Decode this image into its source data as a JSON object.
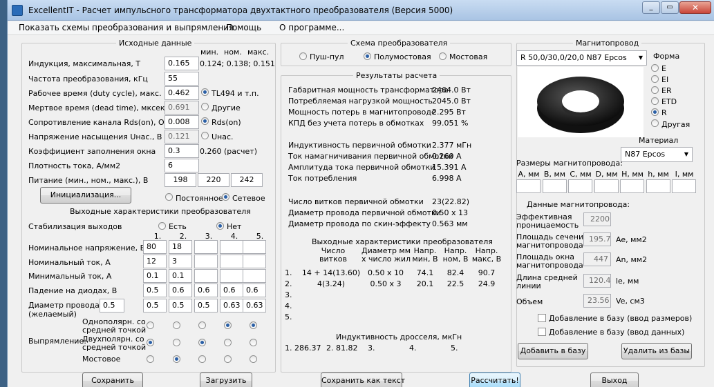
{
  "title": "ExcellentIT - Расчет импульсного трансформатора двухтактного преобразователя (Версия 5000)",
  "menu": [
    "Показать схемы преобразования и выпрямления",
    "Помощь",
    "О программе..."
  ],
  "input": {
    "header": "Исходные данные",
    "col_min": "мин.",
    "col_nom": "ном.",
    "col_max": "макс.",
    "induction_label": "Индукция, максимальная, Т",
    "induction": "0.165",
    "induction_range": "0.124; 0.138; 0.151",
    "freq_label": "Частота преобразования, кГц",
    "freq": "55",
    "duty_label": "Рабочее время (duty cycle), макс.",
    "duty": "0.462",
    "dead_label": "Мертвое время (dead time), мксек",
    "dead": "0.691",
    "rds_label": "Сопротивление канала Rds(on), Ом",
    "rds": "0.008",
    "usat_label": "Напряжение насыщения Uнас., В",
    "usat": "0.121",
    "fill_label": "Коэффициент заполнения окна",
    "fill": "0.3",
    "fill_calc": "0.260 (расчет)",
    "density_label": "Плотность тока, А/мм2",
    "density": "6",
    "supply_label": "Питание (мин., ном., макс.), В",
    "supply": [
      "198",
      "220",
      "242"
    ],
    "radio_tl494": "TL494 и т.п.",
    "radio_other": "Другие",
    "radio_rds": "Rds(on)",
    "radio_usat": "Uнас.",
    "init_btn": "Инициализация...",
    "radio_const": "Постоянное",
    "radio_mains": "Сетевое"
  },
  "outputs": {
    "header": "Выходные характеристики преобразователя",
    "stab_label": "Стабилизация выходов",
    "stab_yes": "Есть",
    "stab_no": "Нет",
    "cols": [
      "1.",
      "2.",
      "3.",
      "4.",
      "5."
    ],
    "vnom_label": "Номинальное напряжение, В",
    "vnom": [
      "80",
      "18",
      "",
      "",
      ""
    ],
    "inom_label": "Номинальный ток, А",
    "inom": [
      "12",
      "3",
      "",
      "",
      ""
    ],
    "imin_label": "Минимальный ток, А",
    "imin": [
      "0.1",
      "0.1",
      "",
      "",
      ""
    ],
    "vd_label": "Падение на диодах, В",
    "vd": [
      "0.5",
      "0.6",
      "0.6",
      "0.6",
      "0.6"
    ],
    "wire_label1": "Диаметр провода",
    "wire_label2": "(желаемый)",
    "wire_default": "0.5",
    "wire": [
      "0.5",
      "0.5",
      "0.5",
      "0.63",
      "0.63"
    ],
    "rect_label": "Выпрямление:",
    "rect_opt1a": "Однополярн. со",
    "rect_opt1b": "средней точкой",
    "rect_opt2a": "Двухполярн. со",
    "rect_opt2b": "средней точкой",
    "rect_opt3": "Мостовое"
  },
  "scheme": {
    "header": "Схема преобразователя",
    "push_pull": "Пуш-пул",
    "half_bridge": "Полумостовая",
    "bridge": "Мостовая"
  },
  "results": {
    "header": "Результаты расчета",
    "rows1": [
      [
        "Габаритная мощность трансформатора",
        "2464.0 Вт"
      ],
      [
        "Потребляемая нагрузкой мощность",
        "2045.0 Вт"
      ],
      [
        "Мощность потерь в магнитопроводе",
        "2.295 Вт"
      ],
      [
        "КПД без учета потерь в обмотках",
        "99.051 %"
      ]
    ],
    "rows2": [
      [
        "Индуктивность первичной обмотки",
        "2.377 мГн"
      ],
      [
        "Ток намагничивания первичной обмотки",
        "0.260 А"
      ],
      [
        "Амплитуда тока первичной обмотки",
        "15.391 А"
      ],
      [
        "Ток потребления",
        "6.998 А"
      ]
    ],
    "rows3": [
      [
        "Число витков первичной обмотки",
        "23(22.82)"
      ],
      [
        "Диаметр провода первичной обмотки",
        "0.50 x 13"
      ],
      [
        "Диаметр провода по скин-эффекту",
        "0.563 мм"
      ]
    ],
    "out_header": "Выходные характеристики преобразователя",
    "out_cols": [
      "Число\nвитков",
      "Диаметр мм\nх число жил",
      "Напр.\nмин, В",
      "Напр.\nном, В",
      "Напр.\nмакс, В"
    ],
    "out_rows": [
      [
        "1.",
        "14 + 14(13.60)",
        "0.50 x 10",
        "74.1",
        "82.4",
        "90.7"
      ],
      [
        "2.",
        "4(3.24)",
        "0.50 x 3",
        "20.1",
        "22.5",
        "24.9"
      ],
      [
        "3.",
        "",
        "",
        "",
        "",
        ""
      ],
      [
        "4.",
        "",
        "",
        "",
        "",
        ""
      ],
      [
        "5.",
        "",
        "",
        "",
        "",
        ""
      ]
    ],
    "choke_header": "Индуктивность дросселя, мкГн",
    "choke": [
      "1. 286.37",
      "2. 81.82",
      "3.",
      "4.",
      "5."
    ]
  },
  "core": {
    "header": "Магнитопровод",
    "selected": "R 50,0/30,0/20,0 N87 Epcos",
    "shape_label": "Форма",
    "shapes": [
      "E",
      "EI",
      "ER",
      "ETD",
      "R",
      "Другая"
    ],
    "material_label": "Материал",
    "material": "N87 Epcos",
    "dims_label": "Размеры магнитопровода:",
    "dims": [
      "A, мм",
      "B, мм",
      "C, мм",
      "D, мм",
      "H, мм",
      "h, мм",
      "I, мм"
    ],
    "data_label": "Данные магнитопровода:",
    "perm_label1": "Эффективная",
    "perm_label2": "проницаемость",
    "perm": "2200",
    "ae_label1": "Площадь сечения",
    "ae_label2": "магнитопровода",
    "ae": "195.7",
    "ae_unit": "Ae, мм2",
    "an_label1": "Площадь окна",
    "an_label2": "магнитопровода",
    "an": "447",
    "an_unit": "An, мм2",
    "le_label1": "Длина средней",
    "le_label2": "линии",
    "le": "120.4",
    "le_unit": "le, мм",
    "ve_label": "Объем",
    "ve": "23.56",
    "ve_unit": "Ve, см3",
    "add_dims": "Добавление в базу (ввод размеров)",
    "add_data": "Добавление в базу (ввод данных)",
    "add_btn": "Добавить в базу",
    "del_btn": "Удалить из базы"
  },
  "footer": {
    "save": "Сохранить",
    "load": "Загрузить",
    "save_text": "Сохранить как текст",
    "calc": "Рассчитать!",
    "exit": "Выход"
  }
}
